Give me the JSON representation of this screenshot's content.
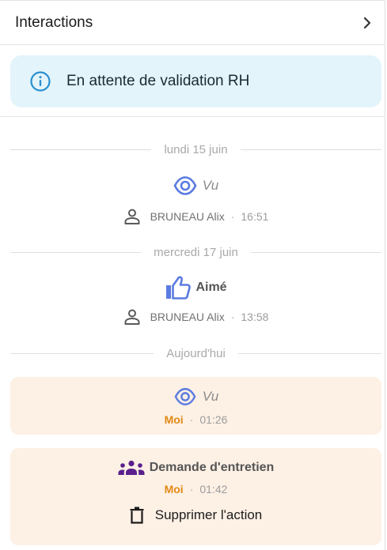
{
  "header": {
    "title": "Interactions",
    "chevron_icon": "chevron-right-icon"
  },
  "banner": {
    "icon": "info-icon",
    "text": "En attente de validation RH"
  },
  "days": [
    {
      "label": "lundi 15 juin"
    },
    {
      "label": "mercredi 17 juin"
    },
    {
      "label": "Aujourd'hui"
    }
  ],
  "events": [
    {
      "type": "vu",
      "icon": "eye-icon",
      "title": "Vu",
      "author": "BRUNEAU Alix",
      "time": "16:51"
    },
    {
      "type": "aime",
      "icon": "thumbs-up-icon",
      "title": "Aimé",
      "author": "BRUNEAU Alix",
      "time": "13:58"
    },
    {
      "type": "vu",
      "icon": "eye-icon",
      "title": "Vu",
      "author": "Moi",
      "time": "01:26"
    },
    {
      "type": "entretien",
      "icon": "group-icon",
      "title": "Demande d'entretien",
      "author": "Moi",
      "time": "01:42",
      "action_label": "Supprimer l'action",
      "action_icon": "trash-icon"
    }
  ],
  "separator": "·",
  "colors": {
    "accent_blue": "#5b7be0",
    "info_blue": "#2a8fd0",
    "banner_bg": "#e3f4fb",
    "card_bg": "#fdf0e5",
    "me_orange": "#e28a14",
    "purple": "#5a1f8c"
  }
}
